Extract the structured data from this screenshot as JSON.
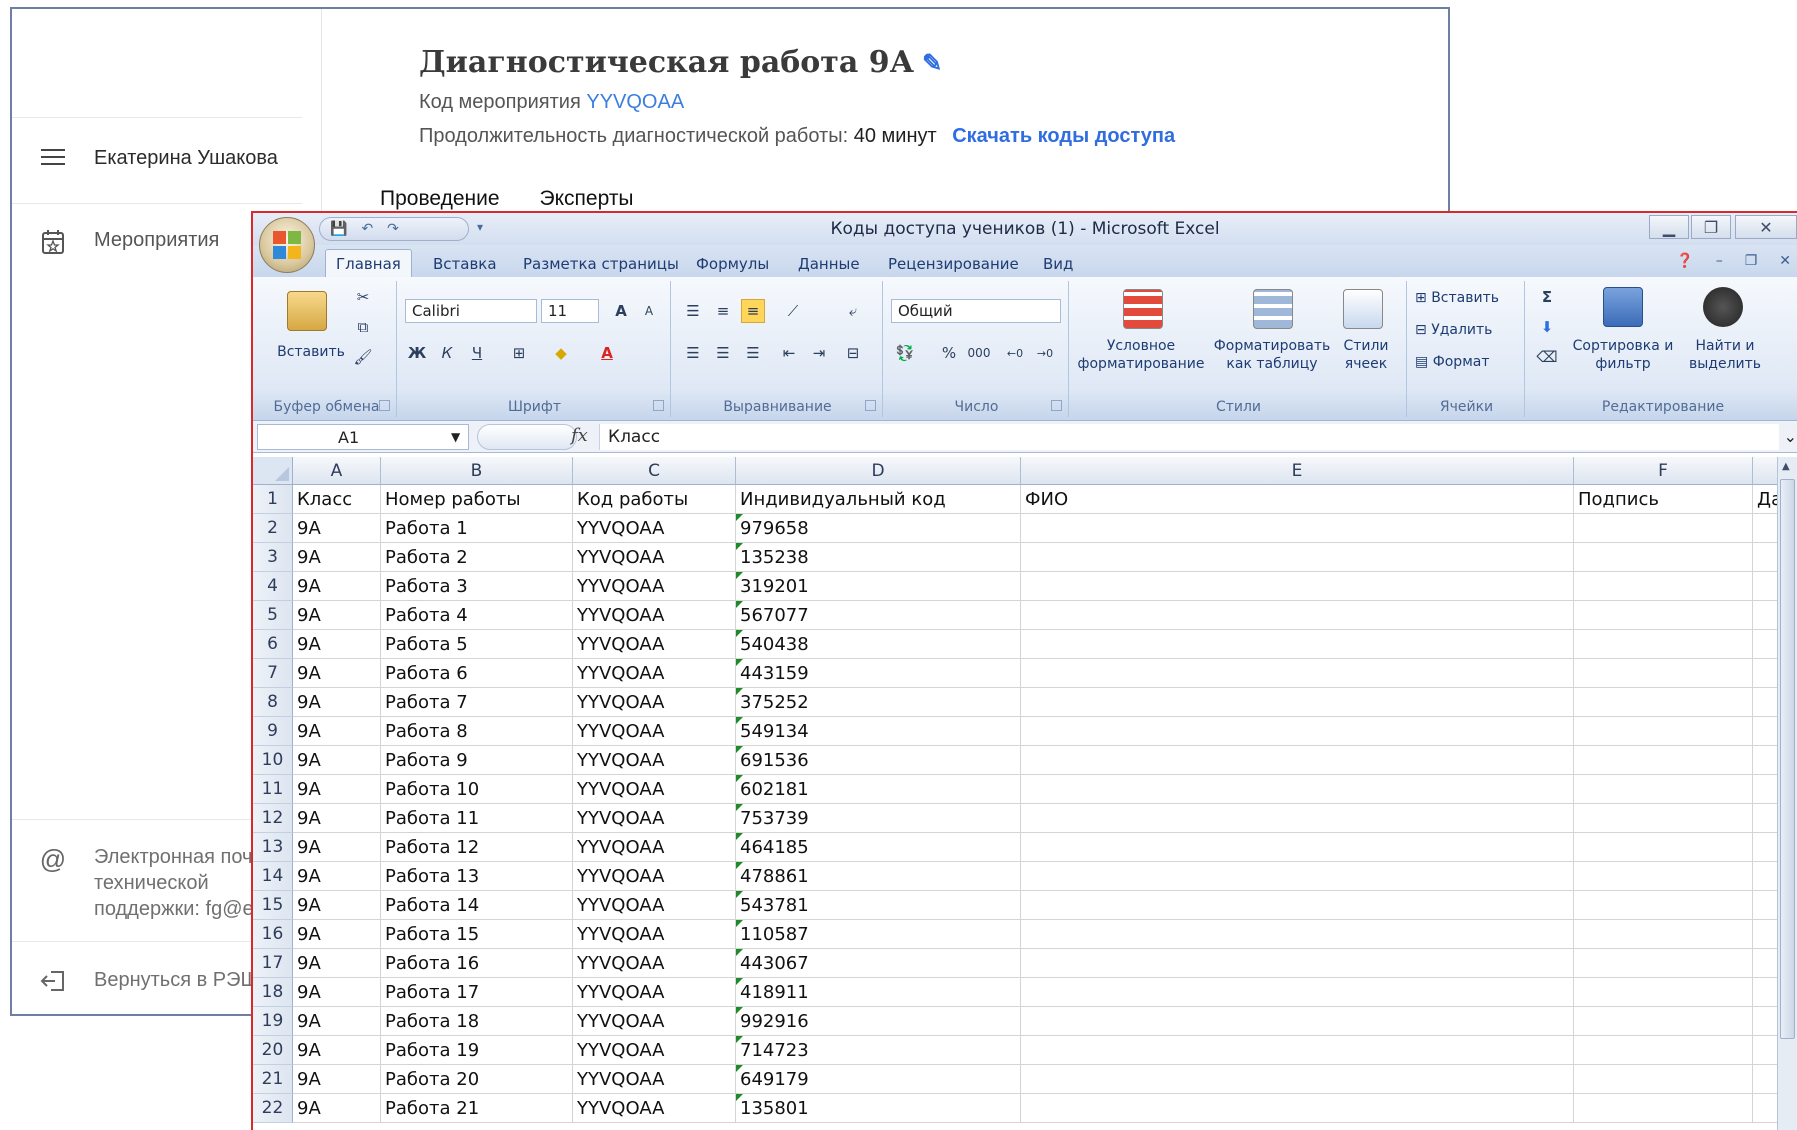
{
  "webapp": {
    "user_name": "Екатерина Ушакова",
    "nav_events": "Мероприятия",
    "support_text": "Электронная почта технической поддержки: fg@e",
    "back_link": "Вернуться в РЭШ",
    "title": "Диагностическая работа 9А",
    "event_code_label": "Код мероприятия",
    "event_code": "YYVQOAA",
    "duration_label": "Продолжительность диагностической работы:",
    "duration_value": "40 минут",
    "download_link": "Скачать коды доступа",
    "tabs": [
      "Проведение",
      "Эксперты"
    ]
  },
  "excel": {
    "window_title": "Коды доступа учеников (1) - Microsoft Excel",
    "ribbon_tabs": [
      "Главная",
      "Вставка",
      "Разметка страницы",
      "Формулы",
      "Данные",
      "Рецензирование",
      "Вид"
    ],
    "active_tab": "Главная",
    "clipboard": {
      "paste": "Вставить",
      "label": "Буфер обмена"
    },
    "font": {
      "name": "Calibri",
      "size": "11",
      "label": "Шрифт",
      "bold": "Ж",
      "italic": "К",
      "underline": "Ч",
      "grow": "A",
      "shrink": "A"
    },
    "alignment": {
      "label": "Выравнивание"
    },
    "number": {
      "format": "Общий",
      "label": "Число",
      "percent": "%",
      "thousands": "000"
    },
    "styles": {
      "conditional": "Условное форматирование",
      "as_table": "Форматировать как таблицу",
      "cell_styles": "Стили ячеек",
      "label": "Стили"
    },
    "cells": {
      "insert": "Вставить",
      "delete": "Удалить",
      "format": "Формат",
      "label": "Ячейки"
    },
    "editing": {
      "sort": "Сортировка и фильтр",
      "find": "Найти и выделить",
      "label": "Редактирование",
      "sigma": "Σ"
    },
    "name_box": "A1",
    "formula": "Класс",
    "columns": [
      "A",
      "B",
      "C",
      "D",
      "E",
      "F"
    ],
    "header_row": [
      "Класс",
      "Номер работы",
      "Код работы",
      "Индивидуальный код",
      "ФИО",
      "Подпись",
      "Да"
    ],
    "rows": [
      [
        "9А",
        "Работа 1",
        "YYVQOAA",
        "979658"
      ],
      [
        "9А",
        "Работа 2",
        "YYVQOAA",
        "135238"
      ],
      [
        "9А",
        "Работа 3",
        "YYVQOAA",
        "319201"
      ],
      [
        "9А",
        "Работа 4",
        "YYVQOAA",
        "567077"
      ],
      [
        "9А",
        "Работа 5",
        "YYVQOAA",
        "540438"
      ],
      [
        "9А",
        "Работа 6",
        "YYVQOAA",
        "443159"
      ],
      [
        "9А",
        "Работа 7",
        "YYVQOAA",
        "375252"
      ],
      [
        "9А",
        "Работа 8",
        "YYVQOAA",
        "549134"
      ],
      [
        "9А",
        "Работа 9",
        "YYVQOAA",
        "691536"
      ],
      [
        "9А",
        "Работа 10",
        "YYVQOAA",
        "602181"
      ],
      [
        "9А",
        "Работа 11",
        "YYVQOAA",
        "753739"
      ],
      [
        "9А",
        "Работа 12",
        "YYVQOAA",
        "464185"
      ],
      [
        "9А",
        "Работа 13",
        "YYVQOAA",
        "478861"
      ],
      [
        "9А",
        "Работа 14",
        "YYVQOAA",
        "543781"
      ],
      [
        "9А",
        "Работа 15",
        "YYVQOAA",
        "110587"
      ],
      [
        "9А",
        "Работа 16",
        "YYVQOAA",
        "443067"
      ],
      [
        "9А",
        "Работа 17",
        "YYVQOAA",
        "418911"
      ],
      [
        "9А",
        "Работа 18",
        "YYVQOAA",
        "992916"
      ],
      [
        "9А",
        "Работа 19",
        "YYVQOAA",
        "714723"
      ],
      [
        "9А",
        "Работа 20",
        "YYVQOAA",
        "649179"
      ],
      [
        "9А",
        "Работа 21",
        "YYVQOAA",
        "135801"
      ]
    ]
  }
}
